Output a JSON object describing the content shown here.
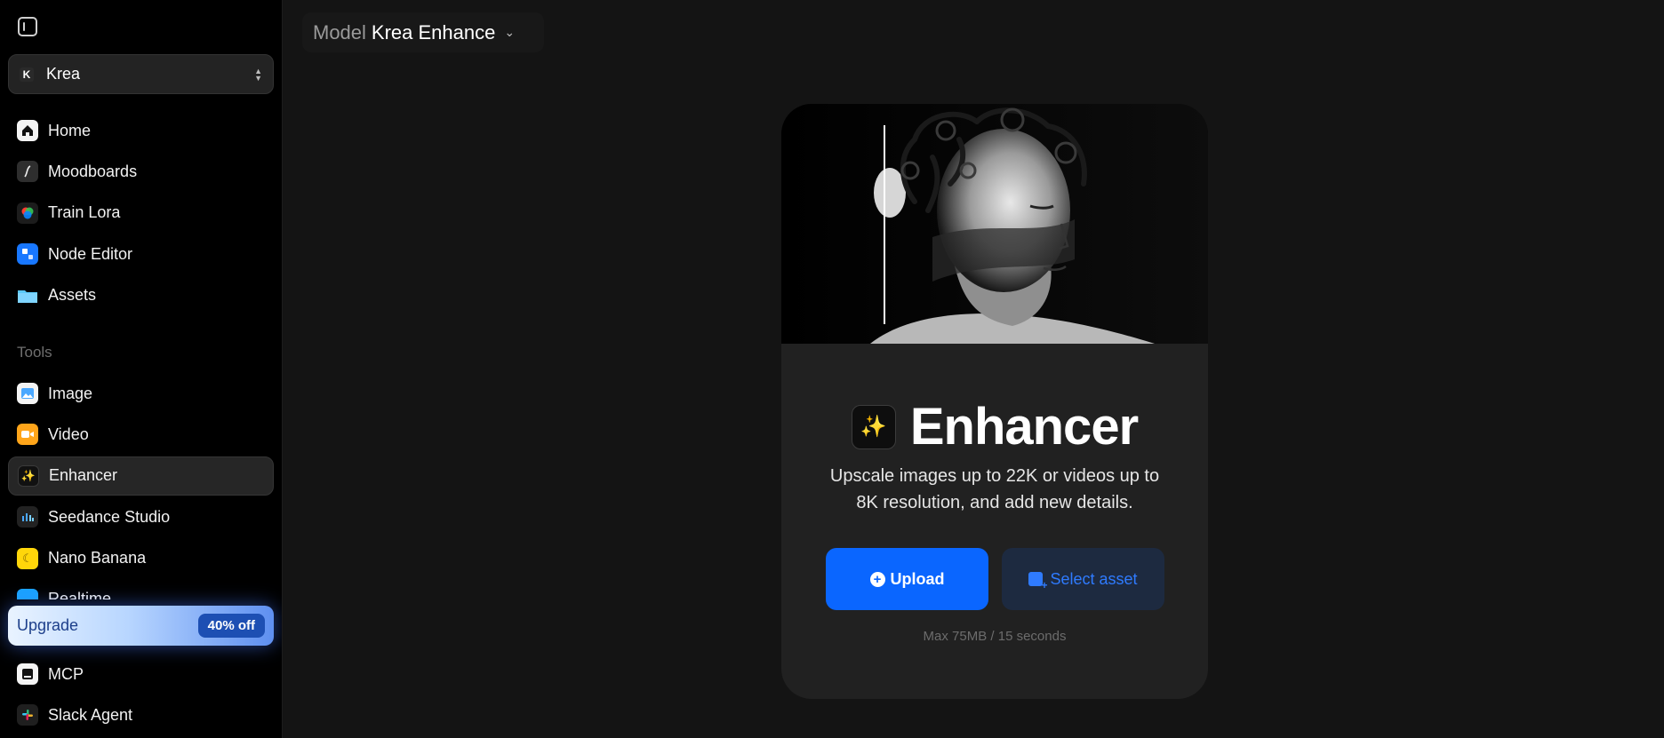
{
  "sidebar": {
    "toggle_icon": "sidebar-toggle-icon",
    "workspace": {
      "name": "Krea",
      "logo": "K"
    },
    "nav_items": [
      {
        "label": "Home",
        "icon": "home-icon"
      },
      {
        "label": "Moodboards",
        "icon": "moodboard-icon"
      },
      {
        "label": "Train Lora",
        "icon": "train-lora-icon"
      },
      {
        "label": "Node Editor",
        "icon": "node-editor-icon"
      },
      {
        "label": "Assets",
        "icon": "folder-icon"
      }
    ],
    "tools_section_label": "Tools",
    "tool_items": [
      {
        "label": "Image",
        "icon": "image-icon"
      },
      {
        "label": "Video",
        "icon": "video-icon"
      },
      {
        "label": "Enhancer",
        "icon": "magic-wand-icon",
        "active": true
      },
      {
        "label": "Seedance Studio",
        "icon": "seedance-icon"
      },
      {
        "label": "Nano Banana",
        "icon": "banana-icon"
      },
      {
        "label": "Realtime",
        "icon": "realtime-icon"
      }
    ],
    "upgrade": {
      "label": "Upgrade",
      "badge": "40% off"
    },
    "bottom_items": [
      {
        "label": "MCP",
        "icon": "mcp-icon"
      },
      {
        "label": "Slack Agent",
        "icon": "slack-icon"
      }
    ]
  },
  "header": {
    "model_prefix": "Model",
    "model_name": "Krea Enhance"
  },
  "card": {
    "title": "Enhancer",
    "subtitle": "Upscale images up to 22K or videos up to 8K resolution, and add new details.",
    "upload_label": "Upload",
    "select_asset_label": "Select asset",
    "limits_text": "Max 75MB / 15 seconds"
  },
  "colors": {
    "accent": "#0a66ff",
    "sidebar_bg": "#000000",
    "main_bg": "#141414",
    "card_bg": "#212121"
  }
}
